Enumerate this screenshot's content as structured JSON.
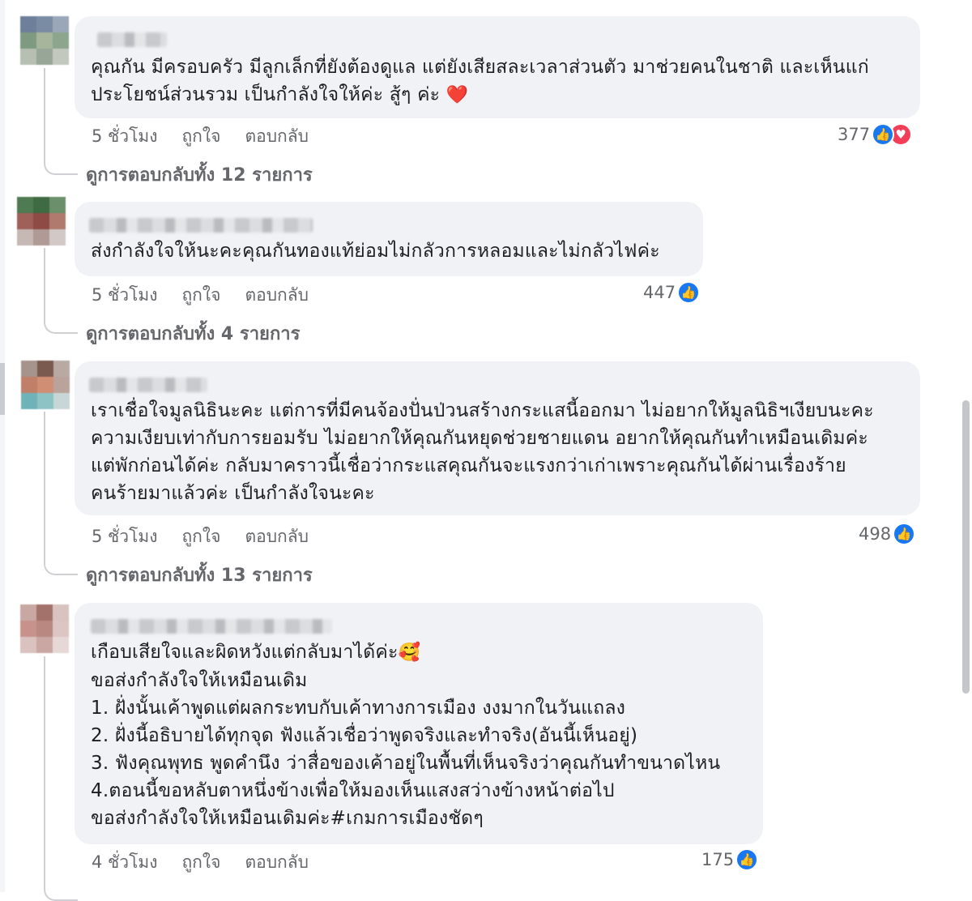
{
  "comments": [
    {
      "text": "คุณกัน มีครอบครัว มีลูกเล็กที่ยังต้องดูแล แต่ยังเสียสละเวลาส่วนตัว มาช่วยคนในชาติ และเห็นแก่\nประโยชน์ส่วนรวม เป็นกำลังใจให้ค่ะ สู้ๆ ค่ะ",
      "emoji": "❤️",
      "time": "5 ชั่วโมง",
      "like": "ถูกใจ",
      "reply": "ตอบกลับ",
      "reactions": "377",
      "reaction_icons": [
        "like-icon",
        "heart-icon"
      ],
      "view_replies": "ดูการตอบกลับทั้ง 12 รายการ"
    },
    {
      "text": "ส่งกำลังใจให้นะคะคุณกันทองแท้ย่อมไม่กลัวการหลอมและไม่กลัวไฟค่ะ",
      "time": "5 ชั่วโมง",
      "like": "ถูกใจ",
      "reply": "ตอบกลับ",
      "reactions": "447",
      "reaction_icons": [
        "like-icon"
      ],
      "view_replies": "ดูการตอบกลับทั้ง 4 รายการ"
    },
    {
      "text": "เราเชื่อใจมูลนิธินะคะ แต่การที่มีคนจ้องปั่นป่วนสร้างกระแสนี้ออกมา ไม่อยากให้มูลนิธิฯเงียบนะคะ\nความเงียบเท่ากับการยอมรับ ไม่อยากให้คุณกันหยุดช่วยชายแดน อยากให้คุณกันทำเหมือนเดิมค่ะ\nแต่พักก่อนได้ค่ะ กลับมาคราวนี้เชื่อว่ากระแสคุณกันจะแรงกว่าเก่าเพราะคุณกันได้ผ่านเรื่องร้าย\nคนร้ายมาแล้วค่ะ เป็นกำลังใจนะคะ",
      "time": "5 ชั่วโมง",
      "like": "ถูกใจ",
      "reply": "ตอบกลับ",
      "reactions": "498",
      "reaction_icons": [
        "like-icon"
      ],
      "view_replies": "ดูการตอบกลับทั้ง 13 รายการ"
    },
    {
      "first_line": "เกือบเสียใจและผิดหวังแต่กลับมาได้ค่ะ",
      "emoji": "🥰",
      "text": "ขอส่งกำลังใจให้เหมือนเดิม\n1. ฝั่งนั้นเค้าพูดแต่ผลกระทบกับเค้าทางการเมือง งงมากในวันแถลง\n2. ฝั่งนี้อธิบายได้ทุกจุด ฟังแล้วเชื่อว่าพูดจริงและทำจริง(อันนี้เห็นอยู่)\n3. ฟังคุณพุทธ พูดคำนึง ว่าสื่อของเค้าอยู่ในพื้นที่เห็นจริงว่าคุณกันทำขนาดไหน\n4.ตอนนี้ขอหลับตาหนึ่งข้างเพื่อให้มองเห็นแสงสว่างข้างหน้าต่อไป\nขอส่งกำลังใจให้เหมือนเดิมค่ะ#เกมการเมืองชัดๆ",
      "time": "4 ชั่วโมง",
      "like": "ถูกใจ",
      "reply": "ตอบกลับ",
      "reactions": "175",
      "reaction_icons": [
        "like-icon"
      ]
    }
  ],
  "colors": {
    "bubble": "#f0f2f5",
    "meta_text": "#65676b",
    "like_blue": "#1877f2",
    "love_red": "#f33e58"
  }
}
